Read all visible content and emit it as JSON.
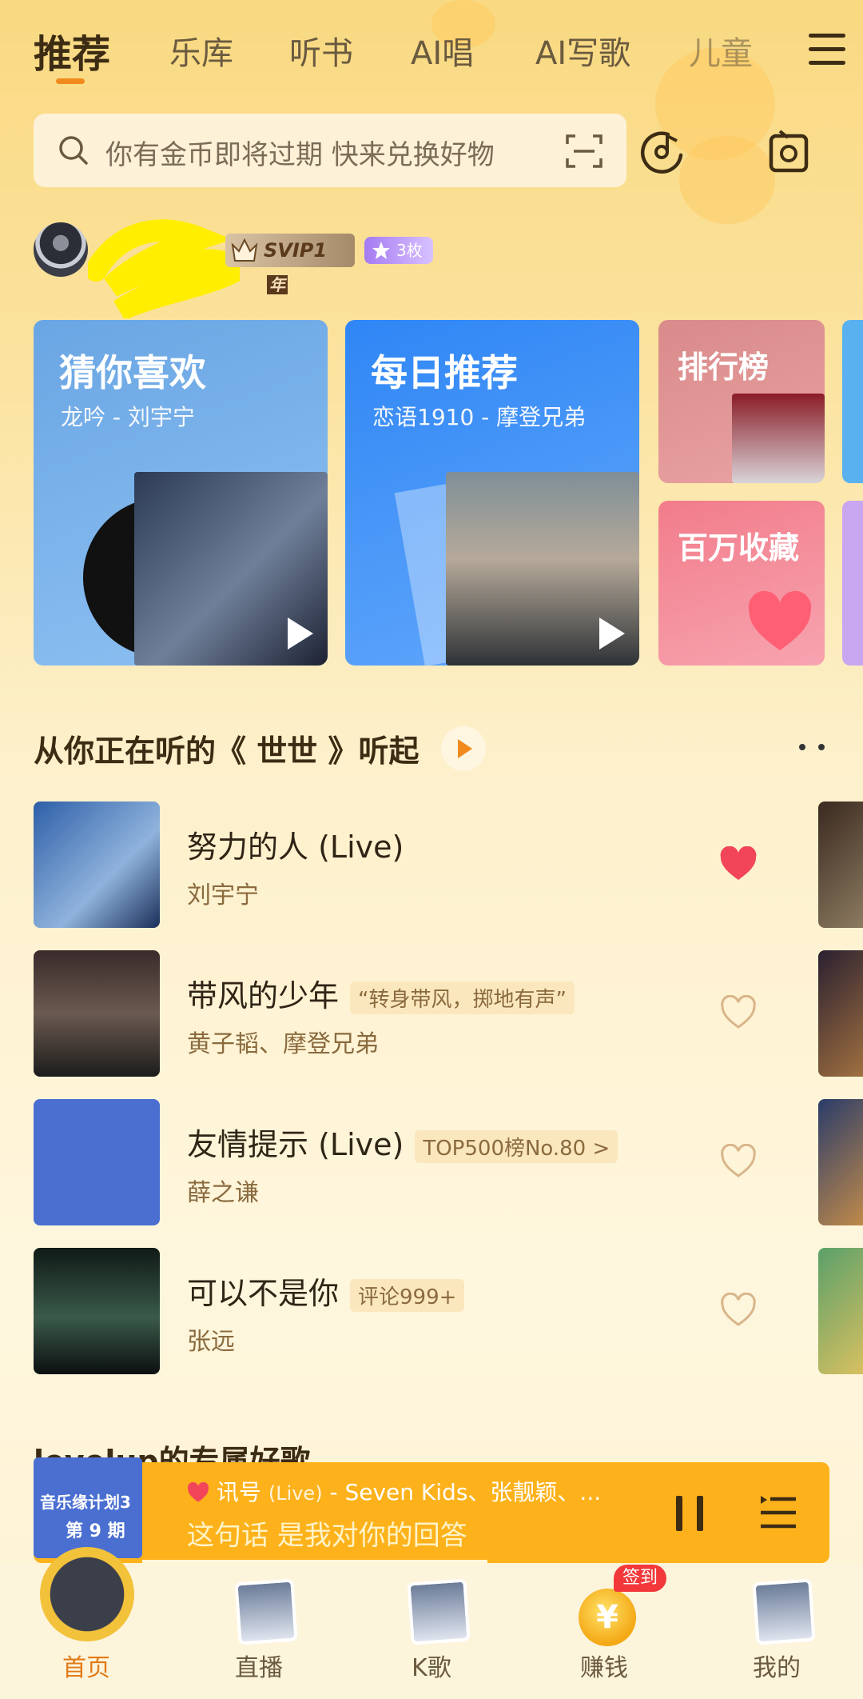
{
  "tabs": [
    {
      "label": "推荐",
      "active": true
    },
    {
      "label": "乐库"
    },
    {
      "label": "听书"
    },
    {
      "label": "AI唱"
    },
    {
      "label": "AI写歌"
    },
    {
      "label": "儿童"
    }
  ],
  "search": {
    "placeholder": "你有金币即将过期  快来兑换好物"
  },
  "user": {
    "vip_label": "SVIP1",
    "vip_suffix": "年",
    "badge_count": "3枚"
  },
  "cards": {
    "guess": {
      "title": "猜你喜欢",
      "subtitle": "龙吟 - 刘宇宁"
    },
    "daily": {
      "title": "每日推荐",
      "subtitle": "恋语1910 - 摩登兄弟"
    },
    "rank": {
      "title": "排行榜"
    },
    "collect": {
      "title": "百万收藏"
    }
  },
  "section": {
    "title": "从你正在听的《 世世 》听起"
  },
  "songs": [
    {
      "name": "努力的人 (Live)",
      "tag": "",
      "artist": "刘宇宁",
      "liked": true
    },
    {
      "name": "带风的少年",
      "tag": "“转身带风，掷地有声”",
      "artist": "黄子韬、摩登兄弟",
      "liked": false
    },
    {
      "name": "友情提示 (Live)",
      "tag": "TOP500榜No.80 >",
      "artist": "薛之谦",
      "liked": false
    },
    {
      "name": "可以不是你",
      "tag": "评论999+",
      "artist": "张远",
      "liked": false
    }
  ],
  "next_section": {
    "title": "levelup的专属好歌"
  },
  "player": {
    "track": "讯号",
    "live": "(Live)",
    "artists": " -  Seven Kids、张靓颖、...",
    "lyric": "这句话 是我对你的回答",
    "cover_text_1": "音乐缘计划3",
    "cover_text_2": "第 9 期",
    "progress": 0.52
  },
  "nav": [
    {
      "label": "首页",
      "active": true
    },
    {
      "label": "直播"
    },
    {
      "label": "K歌"
    },
    {
      "label": "赚钱",
      "badge": "签到"
    },
    {
      "label": "我的"
    }
  ],
  "colors": {
    "accent": "#f08a1c",
    "player_bg": "#fdb21b",
    "liked_heart": "#f2455a"
  }
}
